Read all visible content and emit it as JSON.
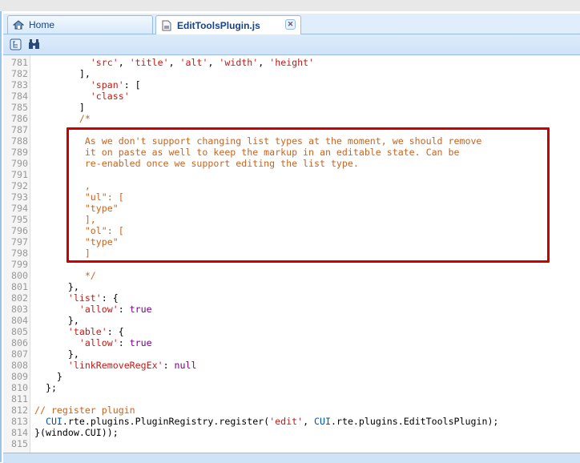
{
  "tabs": [
    {
      "label": "Home",
      "icon": "home-icon"
    },
    {
      "label": "EditToolsPlugin.js",
      "icon": "file-icon",
      "active": true
    }
  ],
  "toolbar": [
    {
      "icon": "outline-icon"
    },
    {
      "icon": "binoculars-find-icon"
    }
  ],
  "highlight_color": "#cc0000",
  "lines": [
    {
      "n": "781",
      "t": [
        [
          "          ",
          ""
        ],
        [
          "'src'",
          "s"
        ],
        [
          ", ",
          ""
        ],
        [
          "'title'",
          "s"
        ],
        [
          ", ",
          ""
        ],
        [
          "'alt'",
          "s"
        ],
        [
          ", ",
          ""
        ],
        [
          "'width'",
          "s"
        ],
        [
          ", ",
          ""
        ],
        [
          "'height'",
          "s"
        ]
      ]
    },
    {
      "n": "782",
      "t": [
        [
          "        ],",
          ""
        ]
      ]
    },
    {
      "n": "783",
      "t": [
        [
          "          ",
          ""
        ],
        [
          "'span'",
          "s"
        ],
        [
          ": [",
          ""
        ]
      ]
    },
    {
      "n": "784",
      "t": [
        [
          "          ",
          ""
        ],
        [
          "'class'",
          "s"
        ]
      ]
    },
    {
      "n": "785",
      "t": [
        [
          "        ]",
          ""
        ]
      ]
    },
    {
      "n": "786",
      "t": [
        [
          "        /*",
          "c"
        ]
      ]
    },
    {
      "n": "787",
      "t": []
    },
    {
      "n": "788",
      "t": [
        [
          "         As we don't support changing list types at the moment, we should remove",
          "c"
        ]
      ]
    },
    {
      "n": "789",
      "t": [
        [
          "         it on paste as well to keep the markup in an editable state. Can be",
          "c"
        ]
      ]
    },
    {
      "n": "790",
      "t": [
        [
          "         re-enabled once we support editing the list type.",
          "c"
        ]
      ]
    },
    {
      "n": "791",
      "t": []
    },
    {
      "n": "792",
      "t": [
        [
          "         ,",
          "c"
        ]
      ]
    },
    {
      "n": "793",
      "t": [
        [
          "         \"ul\": [",
          "c"
        ]
      ]
    },
    {
      "n": "794",
      "t": [
        [
          "         \"type\"",
          "c"
        ]
      ]
    },
    {
      "n": "795",
      "t": [
        [
          "         ],",
          "c"
        ]
      ]
    },
    {
      "n": "796",
      "t": [
        [
          "         \"ol\": [",
          "c"
        ]
      ]
    },
    {
      "n": "797",
      "t": [
        [
          "         \"type\"",
          "c"
        ]
      ]
    },
    {
      "n": "798",
      "t": [
        [
          "         ]",
          "c"
        ]
      ]
    },
    {
      "n": "799",
      "t": []
    },
    {
      "n": "800",
      "t": [
        [
          "         */",
          "c"
        ]
      ]
    },
    {
      "n": "801",
      "t": [
        [
          "      },",
          ""
        ]
      ]
    },
    {
      "n": "802",
      "t": [
        [
          "      ",
          ""
        ],
        [
          "'list'",
          "s"
        ],
        [
          ": {",
          ""
        ]
      ]
    },
    {
      "n": "803",
      "t": [
        [
          "        ",
          ""
        ],
        [
          "'allow'",
          "s"
        ],
        [
          ": ",
          ""
        ],
        [
          "true",
          "k"
        ]
      ]
    },
    {
      "n": "804",
      "t": [
        [
          "      },",
          ""
        ]
      ]
    },
    {
      "n": "805",
      "t": [
        [
          "      ",
          ""
        ],
        [
          "'table'",
          "s"
        ],
        [
          ": {",
          ""
        ]
      ]
    },
    {
      "n": "806",
      "t": [
        [
          "        ",
          ""
        ],
        [
          "'allow'",
          "s"
        ],
        [
          ": ",
          ""
        ],
        [
          "true",
          "k"
        ]
      ]
    },
    {
      "n": "807",
      "t": [
        [
          "      },",
          ""
        ]
      ]
    },
    {
      "n": "808",
      "t": [
        [
          "      ",
          ""
        ],
        [
          "'linkRemoveRegEx'",
          "s"
        ],
        [
          ": ",
          ""
        ],
        [
          "null",
          "k"
        ]
      ]
    },
    {
      "n": "809",
      "t": [
        [
          "    }",
          ""
        ]
      ]
    },
    {
      "n": "810",
      "t": [
        [
          "  };",
          ""
        ]
      ]
    },
    {
      "n": "811",
      "t": []
    },
    {
      "n": "812",
      "t": [
        [
          "// register plugin",
          "c"
        ]
      ]
    },
    {
      "n": "813",
      "t": [
        [
          "  ",
          ""
        ],
        [
          "CUI",
          "v"
        ],
        [
          ".rte.plugins.PluginRegistry.register(",
          ""
        ],
        [
          "'edit'",
          "s"
        ],
        [
          ", ",
          ""
        ],
        [
          "CUI",
          "v"
        ],
        [
          ".rte.plugins.EditToolsPlugin);",
          ""
        ]
      ]
    },
    {
      "n": "814",
      "t": [
        [
          "}(window.CUI));",
          ""
        ]
      ]
    },
    {
      "n": "815",
      "t": []
    }
  ]
}
